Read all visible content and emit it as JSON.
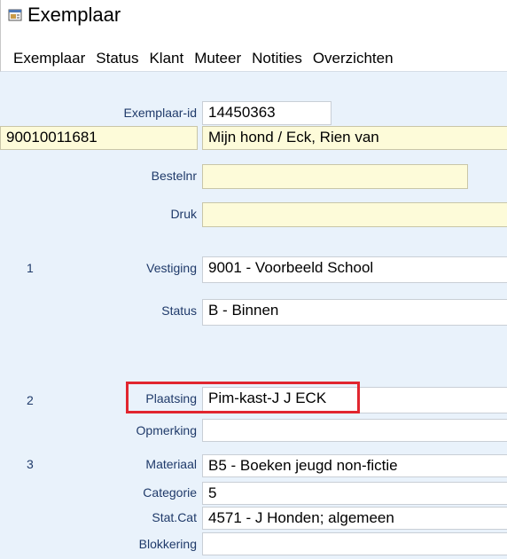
{
  "window": {
    "title": "Exemplaar",
    "icon": "window-app-icon"
  },
  "menu": [
    "Exemplaar",
    "Status",
    "Klant",
    "Muteer",
    "Notities",
    "Overzichten"
  ],
  "form": {
    "exemplaar_id": {
      "label": "Exemplaar-id",
      "value": "14450363"
    },
    "barcode": "90010011681",
    "title_author": "Mijn hond / Eck, Rien van",
    "bestelnr": {
      "label": "Bestelnr",
      "value": ""
    },
    "druk": {
      "label": "Druk",
      "value": ""
    },
    "sections": [
      "1",
      "2",
      "3"
    ],
    "vestiging": {
      "label": "Vestiging",
      "value": "9001 - Voorbeeld School"
    },
    "status": {
      "label": "Status",
      "value": "B - Binnen"
    },
    "plaatsing": {
      "label": "Plaatsing",
      "value": "Pim-kast-J J ECK"
    },
    "opmerking": {
      "label": "Opmerking",
      "value": ""
    },
    "materiaal": {
      "label": "Materiaal",
      "value": "B5 - Boeken jeugd non-fictie"
    },
    "categorie": {
      "label": "Categorie",
      "value": "5"
    },
    "statcat": {
      "label": "Stat.Cat",
      "value": "4571 - J Honden; algemeen"
    },
    "blokkering": {
      "label": "Blokkering",
      "value": ""
    }
  },
  "colors": {
    "highlight": "#e1262f",
    "background": "#e9f2fb",
    "yellow_field": "#fdfbd9",
    "label": "#1f3a6a"
  }
}
